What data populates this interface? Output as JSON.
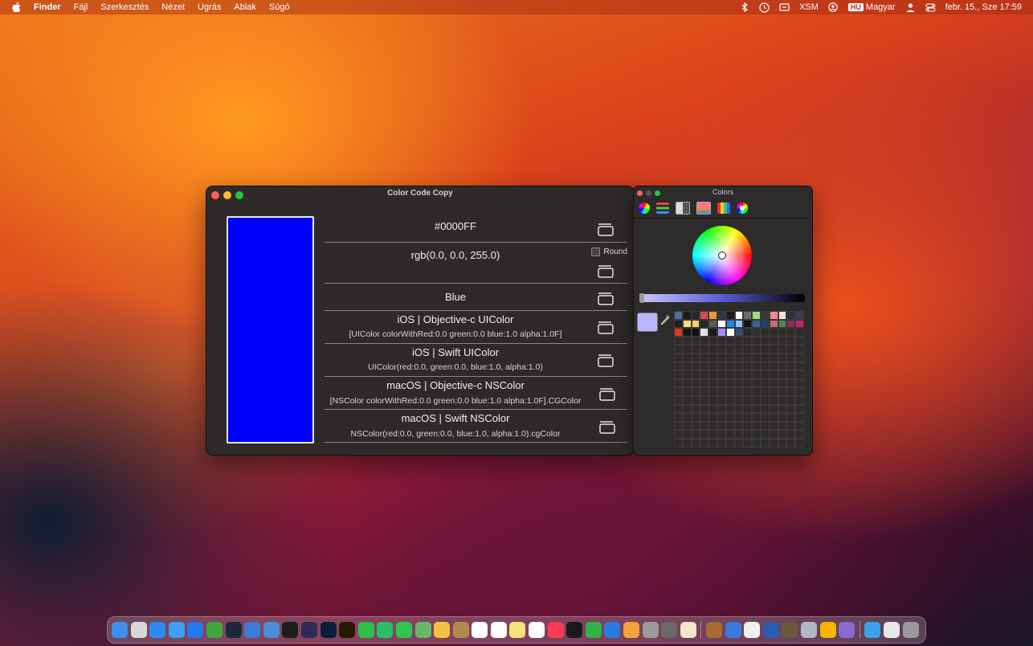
{
  "menubar": {
    "app_name": "Finder",
    "menus": [
      "Fájl",
      "Szerkesztés",
      "Nézet",
      "Ugrás",
      "Ablak",
      "Súgó"
    ],
    "status": {
      "xsm": "XSM",
      "input_source_badge": "HU",
      "input_source_label": "Magyar",
      "datetime": "febr. 15., Sze  17:59"
    }
  },
  "window": {
    "title": "Color Code Copy",
    "swatch_color": "#0000FF",
    "rows": [
      {
        "value": "#0000FF"
      },
      {
        "value": "rgb(0.0, 0.0, 255.0)",
        "round_label": "Round"
      },
      {
        "value": "Blue"
      },
      {
        "value": "iOS | Objective-c UIColor",
        "sub": "[UIColor colorWithRed:0.0 green:0.0 blue:1.0 alpha:1.0F]"
      },
      {
        "value": "iOS | Swift UIColor",
        "sub": "UIColor(red:0.0, green:0.0, blue:1.0, alpha:1.0)"
      },
      {
        "value": "macOS | Objective-c NSColor",
        "sub": "[NSColor colorWithRed:0.0 green:0.0 blue:1.0 alpha:1.0F].CGColor"
      },
      {
        "value": "macOS | Swift NSColor",
        "sub": "NSColor(red:0.0, green:0.0, blue:1.0, alpha:1.0).cgColor"
      }
    ]
  },
  "colors_panel": {
    "title": "Colors",
    "selected_color": "#B9B6FF",
    "palette": [
      "#4a6fa3",
      "#1c1c1c",
      "#262626",
      "#d9474f",
      "#e8963a",
      "#2e3a4a",
      "#1b1b1b",
      "#ffffff",
      "#6e6e6e",
      "#9fdc7c",
      "#3a3a3a",
      "#f08a8a",
      "#f4e0d8",
      "#2d3440",
      "#3b3f52",
      "#1f1f1f",
      "#f5e27a",
      "#f0d070",
      "#262626",
      "#5a5a5a",
      "#ffffff",
      "#1e88e5",
      "#8cc4ff",
      "#111111",
      "#3a5f9a",
      "#224466",
      "#c76b6b",
      "#4a8a5a",
      "#8a2a5a",
      "#c81f6a",
      "#d83a1e",
      "#151515",
      "#111111",
      "#e3e3e3",
      "#1c1c1c",
      "#a28cf5",
      "#ffffff",
      "#3c4a6a",
      "#2b2b2b",
      "#2f2f2f"
    ],
    "toolbar_icons": [
      "color-wheel-icon",
      "sliders-icon",
      "palettes-icon",
      "image-palettes-icon",
      "pencils-icon",
      "extra-wheel-icon"
    ]
  },
  "dock": {
    "icons": [
      "finder-icon",
      "launchpad-icon",
      "mail-icon",
      "safari-icon",
      "app-store-icon",
      "leaf-app-icon",
      "flask-app-icon",
      "xcode-icon",
      "preview-icon",
      "terminal-icon",
      "hex-app-icon",
      "photoshop-icon",
      "illustrator-icon",
      "facetime-icon",
      "find-my-icon",
      "messages-icon",
      "maps-icon",
      "photos-icon",
      "archive-icon",
      "calendar-icon",
      "reminders-icon",
      "notes-icon",
      "freeform-icon",
      "music-icon",
      "tv-icon",
      "numbers-icon",
      "keynote-icon",
      "pages-icon",
      "system-settings-icon",
      "drawing-app-icon",
      "color-picker-icon",
      "monkey-app-icon",
      "chat-app-icon",
      "text-editor-icon",
      "word-icon",
      "bird-app-icon",
      "scanner-icon",
      "sketch-icon",
      "network-icon",
      "folder-icon",
      "drive-icon",
      "trash-icon"
    ],
    "colors": [
      "#3d8ff0",
      "#d8d8d8",
      "#2a8cf2",
      "#3aa0f5",
      "#2478f0",
      "#3fa83a",
      "#1b2a3a",
      "#3e7bd6",
      "#4c8fd9",
      "#1e1e1e",
      "#2d2d56",
      "#0a1f3a",
      "#2a1800",
      "#2fbf4a",
      "#27c06a",
      "#31c450",
      "#65b86a",
      "#f4c040",
      "#b38a4e",
      "#ffffff",
      "#ffffff",
      "#f7e27c",
      "#ffffff",
      "#fa3c53",
      "#1a1a1a",
      "#2fb34a",
      "#2a7be0",
      "#f1a33a",
      "#9a9a9a",
      "#6a6a6a",
      "#f2e7c6",
      "#a86b34",
      "#3a7ae0",
      "#f0f0f0",
      "#2a5bb5",
      "#6a5a3a",
      "#b0b6c2",
      "#f4b400",
      "#8a6ad0",
      "#3ba0e8",
      "#e8e8e8",
      "#9a9a9a"
    ]
  }
}
